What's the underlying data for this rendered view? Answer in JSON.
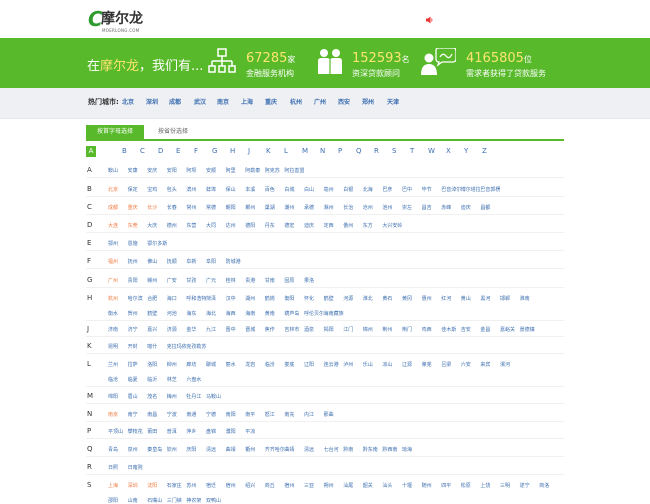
{
  "header": {
    "logo_mark": "C",
    "logo_text": "摩尔龙",
    "logo_sub": "MOERLONG.COM"
  },
  "banner": {
    "slogan_prefix": "在",
    "slogan_brand": "摩尔龙",
    "slogan_suffix": "，我们有...",
    "stats": [
      {
        "num": "67285",
        "unit": "家",
        "desc": "金融服务机构"
      },
      {
        "num": "152593",
        "unit": "名",
        "desc": "资深贷款顾问"
      },
      {
        "num": "4165805",
        "unit": "位",
        "desc": "需求者获得了贷款服务"
      }
    ]
  },
  "hotcity": {
    "label": "热门城市:",
    "cities": [
      "北京",
      "深圳",
      "成都",
      "武汉",
      "南京",
      "上海",
      "重庆",
      "杭州",
      "广州",
      "西安",
      "郑州",
      "天津"
    ]
  },
  "tabs": {
    "active": "按首字母选择",
    "inactive": "按省份选择"
  },
  "letters": [
    "A",
    "B",
    "C",
    "D",
    "E",
    "F",
    "G",
    "H",
    "J",
    "K",
    "L",
    "M",
    "N",
    "P",
    "Q",
    "R",
    "S",
    "T",
    "W",
    "X",
    "Y",
    "Z"
  ],
  "rows": [
    {
      "letter": "A",
      "cities": [
        {
          "n": "鞍山"
        },
        {
          "n": "安康"
        },
        {
          "n": "安庆"
        },
        {
          "n": "安阳"
        },
        {
          "n": "阿坝"
        },
        {
          "n": "安顺"
        },
        {
          "n": "阿里"
        },
        {
          "n": "阿勒泰"
        },
        {
          "n": "阿克苏"
        },
        {
          "n": "阿拉善盟"
        }
      ]
    },
    {
      "letter": "B",
      "cities": [
        {
          "n": "北京",
          "hot": true
        },
        {
          "n": "保定"
        },
        {
          "n": "宝鸡"
        },
        {
          "n": "包头"
        },
        {
          "n": "滨州"
        },
        {
          "n": "蚌埠"
        },
        {
          "n": "保山"
        },
        {
          "n": "本溪"
        },
        {
          "n": "百色"
        },
        {
          "n": "白城"
        },
        {
          "n": "白山"
        },
        {
          "n": "亳州"
        },
        {
          "n": "白银"
        },
        {
          "n": "北海"
        },
        {
          "n": "巴彦"
        },
        {
          "n": "巴中"
        },
        {
          "n": "毕节"
        },
        {
          "n": "巴音淖尔"
        },
        {
          "n": "博尔塔拉"
        },
        {
          "n": "巴音郭楞"
        }
      ]
    },
    {
      "letter": "C",
      "cities": [
        {
          "n": "成都",
          "hot": true
        },
        {
          "n": "重庆",
          "hot": true
        },
        {
          "n": "长沙",
          "hot": true
        },
        {
          "n": "长春"
        },
        {
          "n": "常州"
        },
        {
          "n": "常德"
        },
        {
          "n": "朝阳"
        },
        {
          "n": "郴州"
        },
        {
          "n": "巢湖"
        },
        {
          "n": "潮州"
        },
        {
          "n": "承德"
        },
        {
          "n": "滁州"
        },
        {
          "n": "长治"
        },
        {
          "n": "沧州"
        },
        {
          "n": "池州"
        },
        {
          "n": "崇左"
        },
        {
          "n": "昌吉"
        },
        {
          "n": "赤峰"
        },
        {
          "n": "迪庆"
        },
        {
          "n": "昌都"
        }
      ]
    },
    {
      "letter": "D",
      "cities": [
        {
          "n": "大连",
          "hot": true
        },
        {
          "n": "东莞",
          "hot": true
        },
        {
          "n": "大庆"
        },
        {
          "n": "德州"
        },
        {
          "n": "东营"
        },
        {
          "n": "大同"
        },
        {
          "n": "达州"
        },
        {
          "n": "德阳"
        },
        {
          "n": "丹东"
        },
        {
          "n": "德宏"
        },
        {
          "n": "迪庆"
        },
        {
          "n": "定西"
        },
        {
          "n": "儋州"
        },
        {
          "n": "东方"
        },
        {
          "n": "大兴安岭"
        }
      ]
    },
    {
      "letter": "E",
      "cities": [
        {
          "n": "鄂州"
        },
        {
          "n": "恩施"
        },
        {
          "n": "鄂尔多斯"
        }
      ]
    },
    {
      "letter": "F",
      "cities": [
        {
          "n": "福州",
          "hot": true
        },
        {
          "n": "抚州"
        },
        {
          "n": "佛山"
        },
        {
          "n": "抚顺"
        },
        {
          "n": "阜新"
        },
        {
          "n": "阜阳"
        },
        {
          "n": "防城港"
        }
      ]
    },
    {
      "letter": "G",
      "cities": [
        {
          "n": "广州",
          "hot": true
        },
        {
          "n": "贵阳"
        },
        {
          "n": "赣州"
        },
        {
          "n": "广安"
        },
        {
          "n": "甘孜"
        },
        {
          "n": "广元"
        },
        {
          "n": "桂林"
        },
        {
          "n": "贵港"
        },
        {
          "n": "甘南"
        },
        {
          "n": "固原"
        },
        {
          "n": "果洛"
        }
      ]
    },
    {
      "letter": "H",
      "cities": [
        {
          "n": "杭州",
          "hot": true
        },
        {
          "n": "哈尔滨"
        },
        {
          "n": "合肥"
        },
        {
          "n": "海口"
        },
        {
          "n": "呼和浩特"
        },
        {
          "n": "菏泽"
        },
        {
          "n": "汉中"
        },
        {
          "n": "湖州"
        },
        {
          "n": "鹤岗"
        },
        {
          "n": "衡阳"
        },
        {
          "n": "怀化"
        },
        {
          "n": "鹤壁"
        },
        {
          "n": "河源"
        },
        {
          "n": "淮北"
        },
        {
          "n": "黄石"
        },
        {
          "n": "黄冈"
        },
        {
          "n": "惠州"
        },
        {
          "n": "红河"
        },
        {
          "n": "黄山"
        },
        {
          "n": "黑河"
        },
        {
          "n": "邯郸"
        },
        {
          "n": "淮南"
        }
      ]
    },
    {
      "letter": "",
      "cities": [
        {
          "n": "衡水"
        },
        {
          "n": "贺州"
        },
        {
          "n": "鹤壁"
        },
        {
          "n": "河池"
        },
        {
          "n": "海东"
        },
        {
          "n": "海北"
        },
        {
          "n": "海西"
        },
        {
          "n": "海南"
        },
        {
          "n": "黄南"
        },
        {
          "n": "葫芦岛"
        },
        {
          "n": "呼伦贝尔"
        },
        {
          "n": "海南藏族"
        }
      ]
    },
    {
      "letter": "J",
      "cities": [
        {
          "n": "济南"
        },
        {
          "n": "济宁"
        },
        {
          "n": "嘉兴"
        },
        {
          "n": "济源"
        },
        {
          "n": "金华"
        },
        {
          "n": "九江"
        },
        {
          "n": "晋中"
        },
        {
          "n": "晋城"
        },
        {
          "n": "焦作"
        },
        {
          "n": "吉林市"
        },
        {
          "n": "酒泉"
        },
        {
          "n": "揭阳"
        },
        {
          "n": "江门"
        },
        {
          "n": "锦州"
        },
        {
          "n": "荆州"
        },
        {
          "n": "荆门"
        },
        {
          "n": "鸡西"
        },
        {
          "n": "佳木斯"
        },
        {
          "n": "吉安"
        },
        {
          "n": "金昌"
        },
        {
          "n": "嘉峪关"
        },
        {
          "n": "景德镇"
        }
      ]
    },
    {
      "letter": "K",
      "cities": [
        {
          "n": "昆明"
        },
        {
          "n": "开封"
        },
        {
          "n": "喀什"
        },
        {
          "n": "克拉玛依"
        },
        {
          "n": "克孜勒苏"
        }
      ]
    },
    {
      "letter": "L",
      "cities": [
        {
          "n": "兰州"
        },
        {
          "n": "拉萨"
        },
        {
          "n": "洛阳"
        },
        {
          "n": "柳州"
        },
        {
          "n": "廊坊"
        },
        {
          "n": "聊城"
        },
        {
          "n": "丽水"
        },
        {
          "n": "龙岩"
        },
        {
          "n": "临汾"
        },
        {
          "n": "娄底"
        },
        {
          "n": "辽阳"
        },
        {
          "n": "连云港"
        },
        {
          "n": "泸州"
        },
        {
          "n": "乐山"
        },
        {
          "n": "凉山"
        },
        {
          "n": "辽源"
        },
        {
          "n": "莱芜"
        },
        {
          "n": "吕梁"
        },
        {
          "n": "六安"
        },
        {
          "n": "来宾"
        },
        {
          "n": "漯河"
        }
      ]
    },
    {
      "letter": "",
      "cities": [
        {
          "n": "临沧"
        },
        {
          "n": "临夏"
        },
        {
          "n": "临沂"
        },
        {
          "n": "林芝"
        },
        {
          "n": "六盘水"
        }
      ]
    },
    {
      "letter": "M",
      "cities": [
        {
          "n": "绵阳"
        },
        {
          "n": "眉山"
        },
        {
          "n": "茂名"
        },
        {
          "n": "梅州"
        },
        {
          "n": "牡丹江"
        },
        {
          "n": "马鞍山"
        }
      ]
    },
    {
      "letter": "N",
      "cities": [
        {
          "n": "南京",
          "hot": true
        },
        {
          "n": "南宁"
        },
        {
          "n": "南昌"
        },
        {
          "n": "宁波"
        },
        {
          "n": "南通"
        },
        {
          "n": "宁德"
        },
        {
          "n": "南阳"
        },
        {
          "n": "南平"
        },
        {
          "n": "怒江"
        },
        {
          "n": "南充"
        },
        {
          "n": "内江"
        },
        {
          "n": "那曲"
        }
      ]
    },
    {
      "letter": "P",
      "cities": [
        {
          "n": "平顶山"
        },
        {
          "n": "攀枝花"
        },
        {
          "n": "莆田"
        },
        {
          "n": "普洱"
        },
        {
          "n": "萍乡"
        },
        {
          "n": "盘锦"
        },
        {
          "n": "濮阳"
        },
        {
          "n": "平凉"
        }
      ]
    },
    {
      "letter": "Q",
      "cities": [
        {
          "n": "青岛"
        },
        {
          "n": "泉州"
        },
        {
          "n": "秦皇岛"
        },
        {
          "n": "钦州"
        },
        {
          "n": "庆阳"
        },
        {
          "n": "清远"
        },
        {
          "n": "曲靖"
        },
        {
          "n": "衢州"
        },
        {
          "n": "齐齐哈尔"
        },
        {
          "n": "曲靖"
        },
        {
          "n": "清远"
        },
        {
          "n": "七台河"
        },
        {
          "n": "黔南"
        },
        {
          "n": "黔东南"
        },
        {
          "n": "黔西南"
        },
        {
          "n": "琼海"
        }
      ]
    },
    {
      "letter": "R",
      "cities": [
        {
          "n": "日照"
        },
        {
          "n": "日喀则"
        }
      ]
    },
    {
      "letter": "S",
      "cities": [
        {
          "n": "上海",
          "hot": true
        },
        {
          "n": "深圳",
          "hot": true
        },
        {
          "n": "沈阳",
          "hot": true
        },
        {
          "n": "石家庄"
        },
        {
          "n": "苏州"
        },
        {
          "n": "宿迁"
        },
        {
          "n": "宿州"
        },
        {
          "n": "绍兴"
        },
        {
          "n": "商丘"
        },
        {
          "n": "宿州"
        },
        {
          "n": "三亚"
        },
        {
          "n": "朔州"
        },
        {
          "n": "汕尾"
        },
        {
          "n": "韶关"
        },
        {
          "n": "汕头"
        },
        {
          "n": "十堰"
        },
        {
          "n": "随州"
        },
        {
          "n": "四平"
        },
        {
          "n": "松原"
        },
        {
          "n": "上饶"
        },
        {
          "n": "三明"
        },
        {
          "n": "遂宁"
        },
        {
          "n": "商洛"
        }
      ]
    },
    {
      "letter": "",
      "cities": [
        {
          "n": "邵阳"
        },
        {
          "n": "山南"
        },
        {
          "n": "石嘴山"
        },
        {
          "n": "三门峡"
        },
        {
          "n": "神农架"
        },
        {
          "n": "双鸭山"
        }
      ]
    }
  ]
}
